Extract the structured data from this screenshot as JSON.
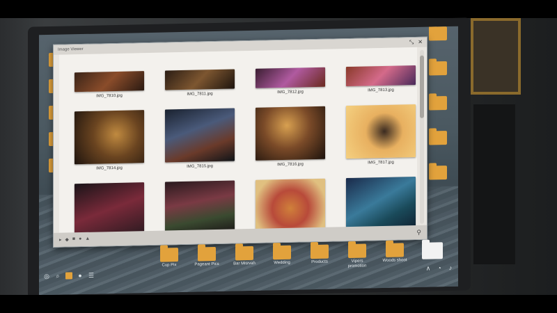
{
  "window": {
    "title": "Image Viewer",
    "controls": [
      "⤡",
      "✕"
    ]
  },
  "photos": [
    {
      "caption": "IMG_7810.jpg",
      "color": "linear-gradient(135deg,#3a2418,#8a4c2a,#2a1a12)",
      "partial": true
    },
    {
      "caption": "IMG_7811.jpg",
      "color": "linear-gradient(135deg,#2b1d14,#7d5630,#1d140e)",
      "partial": true
    },
    {
      "caption": "IMG_7812.jpg",
      "color": "linear-gradient(135deg,#3b1e32,#b05aa0,#6a2a1e)",
      "partial": true
    },
    {
      "caption": "IMG_7813.jpg",
      "color": "linear-gradient(135deg,#8a3a2a,#d46a8a,#4a2a5a)",
      "partial": true
    },
    {
      "caption": "IMG_7814.jpg",
      "color": "radial-gradient(circle at 60% 45%,#c08a40,#6a4420 45%,#1e140e)",
      "partial": false
    },
    {
      "caption": "IMG_7815.jpg",
      "color": "linear-gradient(160deg,#1a2230,#4a5a7a 40%,#6a3a2a 70%,#101418)",
      "partial": false
    },
    {
      "caption": "IMG_7816.jpg",
      "color": "radial-gradient(circle at 45% 35%,#d8a050,#7a4a28 45%,#1c120c)",
      "partial": false
    },
    {
      "caption": "IMG_7817.jpg",
      "color": "radial-gradient(circle at 55% 50%,#3a2a20,#e8b060 40%,#f4d080)",
      "partial": false
    },
    {
      "caption": "IMG_7818.jpg",
      "color": "linear-gradient(160deg,#1a1418,#7a2a3a 50%,#2a1a20)",
      "partial": false
    },
    {
      "caption": "IMG_7819.jpg",
      "color": "linear-gradient(170deg,#2a1a1e,#7a3a44 40%,#3a4a30 70%,#1a1416)",
      "partial": false
    },
    {
      "caption": "IMG_7820.jpg",
      "color": "radial-gradient(circle at 50% 55%,#d0803a,#b84a3a 40%,#e0c080 80%)",
      "partial": false
    },
    {
      "caption": "IMG_7821.jpg",
      "color": "linear-gradient(150deg,#1a2a4a,#3a7a9a 45%,#1a4a5a 70%,#102030)",
      "partial": false
    },
    {
      "caption": "",
      "color": "linear-gradient(180deg,#3a1a2a,#1a1014)",
      "partial": true
    },
    {
      "caption": "",
      "color": "linear-gradient(180deg,#2a2a3a,#14141c)",
      "partial": true
    },
    {
      "caption": "",
      "color": "linear-gradient(180deg,#6a4a3a,#2a1a14)",
      "partial": true
    },
    {
      "caption": "",
      "color": "linear-gradient(180deg,#c89060,#6a4a30)",
      "partial": true
    }
  ],
  "desktop_right": [
    {
      "label": ""
    },
    {
      "label": ""
    },
    {
      "label": ""
    },
    {
      "label": ""
    },
    {
      "label": ""
    }
  ],
  "bottom_folders": [
    {
      "label": "Cup Pix"
    },
    {
      "label": "Pageant Pics"
    },
    {
      "label": "Bar Mitzvah"
    },
    {
      "label": "Wedding"
    },
    {
      "label": "Products"
    },
    {
      "label": "Vipers promotion"
    },
    {
      "label": "Woods shoot"
    },
    {
      "label": ""
    }
  ],
  "taskbar": {
    "left_icons": [
      "◎",
      "⌕",
      "",
      "●",
      "☰"
    ],
    "right_icons": [
      "∧",
      "◔",
      "♪"
    ]
  }
}
